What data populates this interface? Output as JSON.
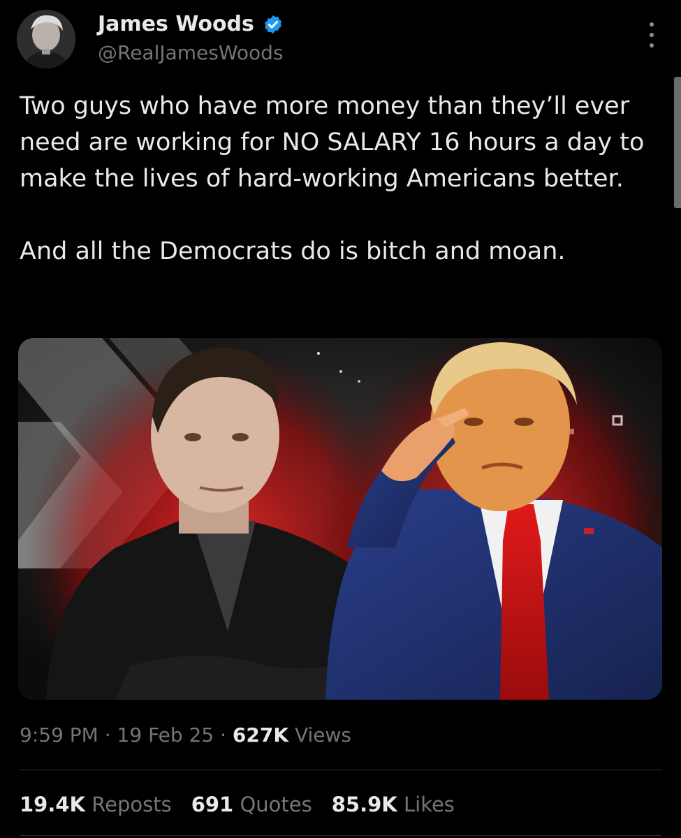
{
  "author": {
    "display_name": "James Woods",
    "handle": "@RealJamesWoods",
    "verified": true,
    "verified_color": "#1d9bf0"
  },
  "tweet": {
    "paragraphs": [
      "Two guys who have more money than they’ll ever need are working for NO SALARY 16 hours a day to make the lives of hard-working Americans better.",
      "And all the Democrats do is bitch and moan."
    ],
    "media_description_icon": "photo-icon"
  },
  "meta": {
    "time": "9:59 PM",
    "separator": "·",
    "date": "19 Feb 25",
    "views_count": "627K",
    "views_label": "Views"
  },
  "stats": {
    "reposts_count": "19.4K",
    "reposts_label": "Reposts",
    "quotes_count": "691",
    "quotes_label": "Quotes",
    "likes_count": "85.9K",
    "likes_label": "Likes"
  },
  "colors": {
    "background": "#000000",
    "text_primary": "#e7e9ea",
    "text_secondary": "#71767b",
    "divider": "#2f3336",
    "accent_red": "#d01818"
  }
}
